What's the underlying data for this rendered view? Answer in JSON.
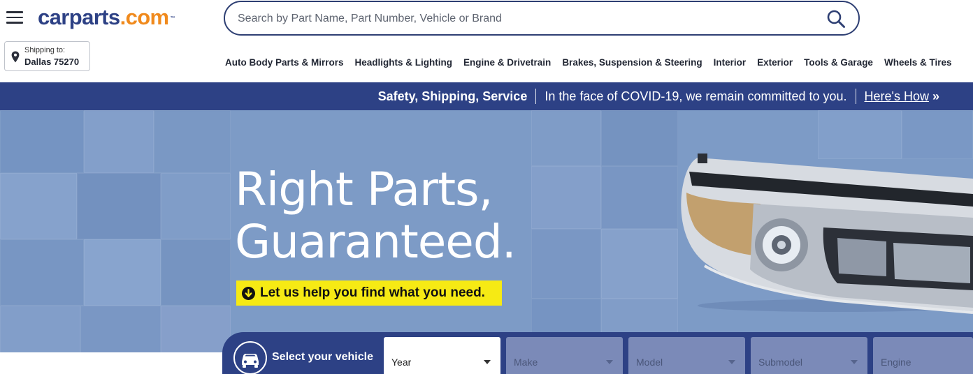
{
  "header": {
    "logo_main": "carparts",
    "logo_ext": ".com",
    "logo_tm": "™",
    "search_placeholder": "Search by Part Name, Part Number, Vehicle or Brand",
    "shipping_label": "Shipping to:",
    "shipping_location": "Dallas 75270"
  },
  "nav": {
    "items": [
      {
        "label": "Auto Body Parts & Mirrors"
      },
      {
        "label": "Headlights & Lighting"
      },
      {
        "label": "Engine & Drivetrain"
      },
      {
        "label": "Brakes, Suspension & Steering"
      },
      {
        "label": "Interior"
      },
      {
        "label": "Exterior"
      },
      {
        "label": "Tools & Garage"
      },
      {
        "label": "Wheels & Tires"
      }
    ]
  },
  "promo": {
    "bold": "Safety, Shipping, Service",
    "message": "In the face of COVID-19, we remain committed to you.",
    "link": "Here's How",
    "link_suffix": "»"
  },
  "hero": {
    "title_line1": "Right Parts,",
    "title_line2": "Guaranteed.",
    "help_text": "Let us help you find what you need."
  },
  "selector": {
    "label": "Select your vehicle",
    "fields": [
      {
        "label": "Year",
        "state": "active"
      },
      {
        "label": "Make",
        "state": "disabled"
      },
      {
        "label": "Model",
        "state": "disabled"
      },
      {
        "label": "Submodel",
        "state": "disabled"
      },
      {
        "label": "Engine",
        "state": "disabled"
      }
    ]
  },
  "colors": {
    "brand_blue": "#2d4185",
    "brand_orange": "#f08a1d",
    "hero_bg": "#7d9bc6",
    "help_yellow": "#f6ea14"
  },
  "icons": [
    "menu-icon",
    "search-icon",
    "location-pin-icon",
    "arrow-down-circle-icon",
    "car-icon",
    "chevron-down-icon"
  ]
}
